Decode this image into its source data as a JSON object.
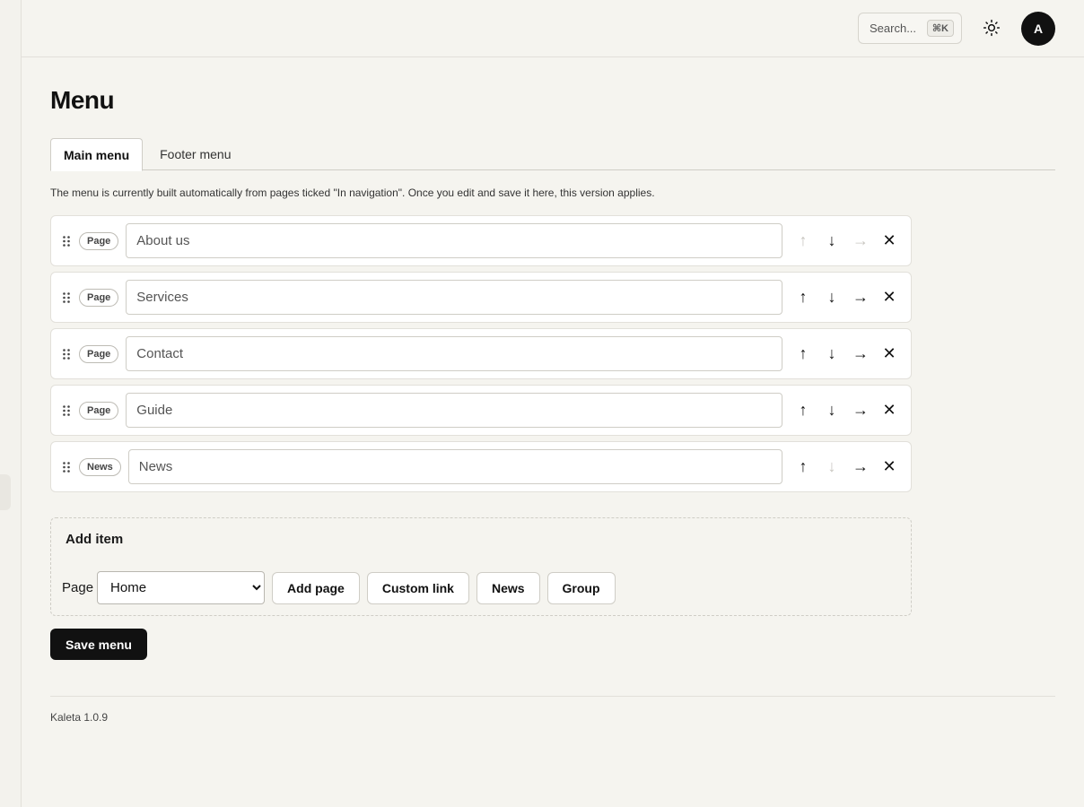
{
  "header": {
    "search_placeholder": "Search...",
    "search_shortcut": "⌘K",
    "theme_icon": "sun-icon",
    "avatar_initial": "A"
  },
  "page": {
    "title": "Menu",
    "tabs": [
      {
        "label": "Main menu",
        "active": true
      },
      {
        "label": "Footer menu",
        "active": false
      }
    ],
    "help_text": "The menu is currently built automatically from pages ticked \"In navigation\". Once you edit and save it here, this version applies."
  },
  "menu_items": [
    {
      "type": "Page",
      "label": "About us",
      "up_enabled": false,
      "down_enabled": true,
      "indent_enabled": false
    },
    {
      "type": "Page",
      "label": "Services",
      "up_enabled": true,
      "down_enabled": true,
      "indent_enabled": true
    },
    {
      "type": "Page",
      "label": "Contact",
      "up_enabled": true,
      "down_enabled": true,
      "indent_enabled": true
    },
    {
      "type": "Page",
      "label": "Guide",
      "up_enabled": true,
      "down_enabled": true,
      "indent_enabled": true
    },
    {
      "type": "News",
      "label": "News",
      "up_enabled": true,
      "down_enabled": false,
      "indent_enabled": true
    }
  ],
  "row_actions": {
    "up_glyph": "↑",
    "down_glyph": "↓",
    "indent_glyph": "→",
    "remove_glyph": "✕"
  },
  "add_item": {
    "title": "Add item",
    "page_label": "Page",
    "page_selected": "Home",
    "add_page_label": "Add page",
    "custom_link_label": "Custom link",
    "news_label": "News",
    "group_label": "Group"
  },
  "save_label": "Save menu",
  "footer": {
    "version": "Kaleta 1.0.9"
  },
  "colors": {
    "background": "#f5f4ef",
    "primary": "#111111",
    "border": "#cfcdc6",
    "disabled": "#c8c6c0"
  }
}
